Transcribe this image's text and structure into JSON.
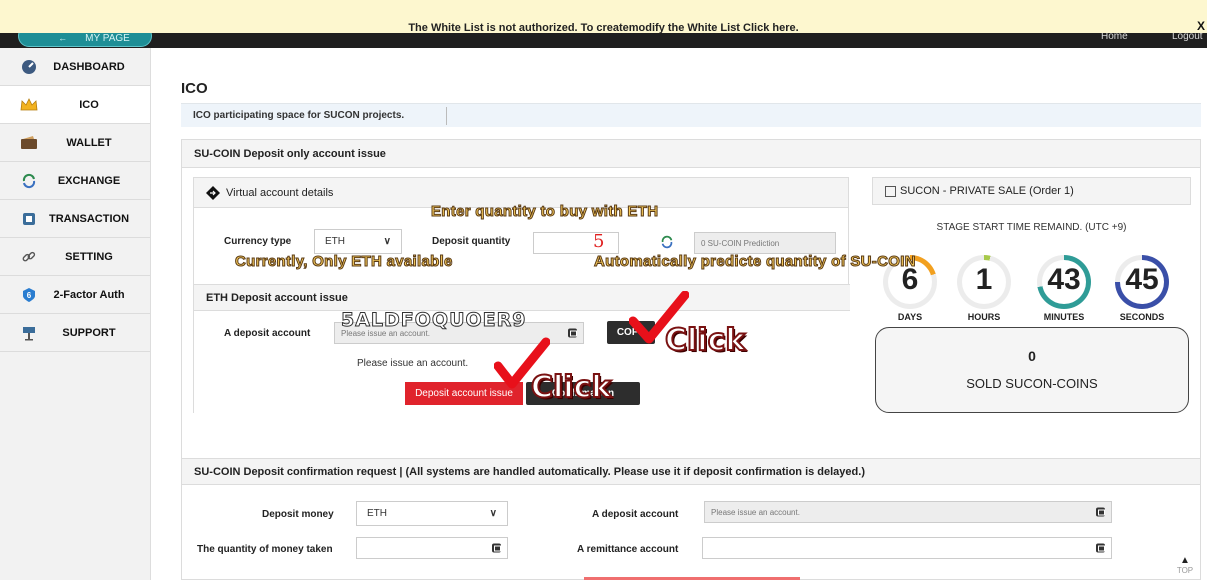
{
  "notice": {
    "text": "The White List is not authorized. To createmodify the White List Click here.",
    "close": "X"
  },
  "topbar": {
    "mypage": "MY PAGE",
    "home": "Home",
    "logout": "Logout"
  },
  "sidebar": {
    "items": [
      {
        "label": "DASHBOARD",
        "icon": "dashboard-gauge-icon"
      },
      {
        "label": "ICO",
        "icon": "crown-icon"
      },
      {
        "label": "WALLET",
        "icon": "wallet-icon"
      },
      {
        "label": "EXCHANGE",
        "icon": "exchange-icon"
      },
      {
        "label": "TRANSACTION",
        "icon": "transaction-icon"
      },
      {
        "label": "SETTING",
        "icon": "setting-link-icon"
      },
      {
        "label": "2-Factor Auth",
        "icon": "two-factor-shield-icon"
      },
      {
        "label": "SUPPORT",
        "icon": "support-sign-icon"
      }
    ],
    "active": "ICO"
  },
  "page": {
    "title": "ICO",
    "intro": "ICO participating space for SUCON projects."
  },
  "issue_panel": {
    "title": "SU-COIN Deposit only account issue",
    "virtual": {
      "title": "Virtual account details",
      "currency_label": "Currency type",
      "currency_value": "ETH",
      "quantity_label": "Deposit quantity",
      "prediction_placeholder": "0 SU-COIN Prediction"
    },
    "eth": {
      "title": "ETH Deposit account issue",
      "account_label": "A deposit account",
      "account_placeholder": "Please issue an account.",
      "copy_button": "COPY",
      "hint": "Please issue an account.",
      "issue_button": "Deposit account issue",
      "confirm_button": "Confirmation"
    }
  },
  "sale": {
    "title": "SUCON - PRIVATE SALE (Order 1)",
    "stage": "STAGE START TIME REMAIND. (UTC +9)",
    "countdown": [
      {
        "value": "6",
        "label": "DAYS",
        "color": "#f2a01f",
        "progress": 0.2
      },
      {
        "value": "1",
        "label": "HOURS",
        "color": "#a7c94a",
        "progress": 0.04
      },
      {
        "value": "43",
        "label": "MINUTES",
        "color": "#2f9c97",
        "progress": 0.72
      },
      {
        "value": "45",
        "label": "SECONDS",
        "color": "#3a4fa8",
        "progress": 0.75
      }
    ],
    "sold_value": "0",
    "sold_label": "SOLD SUCON-COINS"
  },
  "confirm_panel": {
    "title": "SU-COIN Deposit confirmation request | (All systems are handled automatically. Please use it if deposit confirmation is delayed.)",
    "money_label": "Deposit money",
    "money_value": "ETH",
    "account_label": "A deposit account",
    "account_placeholder": "Please issue an account.",
    "taken_label": "The quantity of money taken",
    "remit_label": "A remittance account"
  },
  "overlays": {
    "enter_qty": "Enter quantity to buy with ETH",
    "only_eth": "Currently, Only ETH available",
    "auto_predict": "Automatically predicte quantity of SU-COIN",
    "qty_value": "5",
    "address": "5ALDFOQUOER9",
    "click1": "Click",
    "click2": "Click"
  },
  "top_button": "TOP"
}
